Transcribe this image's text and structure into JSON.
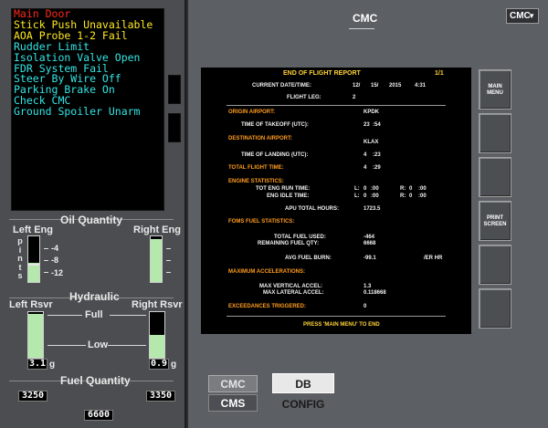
{
  "eicas": {
    "messages": [
      {
        "text": "Main Door",
        "level": "warn"
      },
      {
        "text": "Stick Push Unavailable",
        "level": "caution"
      },
      {
        "text": "AOA Probe 1-2 Fail",
        "level": "caution"
      },
      {
        "text": "Rudder Limit",
        "level": "advisory"
      },
      {
        "text": "Isolation Valve Open",
        "level": "advisory"
      },
      {
        "text": "FDR System Fail",
        "level": "advisory"
      },
      {
        "text": "Steer By Wire Off",
        "level": "advisory"
      },
      {
        "text": "Parking Brake On",
        "level": "advisory"
      },
      {
        "text": "Check CMC",
        "level": "advisory"
      },
      {
        "text": "Ground Spoiler Unarm",
        "level": "advisory"
      }
    ]
  },
  "oil": {
    "title": "Oil Quantity",
    "left_label": "Left Eng",
    "right_label": "Right Eng",
    "unit_vertical": [
      "p",
      "i",
      "n",
      "t",
      "s"
    ],
    "ticks": [
      "-4",
      "-8",
      "-12"
    ],
    "left_level": 0.42,
    "right_level": 0.95
  },
  "hydraulic": {
    "title": "Hydraulic",
    "left_label": "Left Rsvr",
    "right_label": "Right Rsvr",
    "full_label": "Full",
    "low_label": "Low",
    "left_value": "3.1",
    "right_value": "0.9",
    "unit": "g",
    "left_level": 0.97,
    "right_level": 0.5
  },
  "fuel": {
    "title": "Fuel Quantity",
    "left_value": "3250",
    "right_value": "3350",
    "total_value": "6600"
  },
  "cmc": {
    "title": "CMC",
    "select_value": "CMC",
    "select_chevron": "▼"
  },
  "report": {
    "title": "END OF FLIGHT REPORT",
    "page": "1/1",
    "date_label": "CURRENT DATE/TIME:",
    "date_month": "12/",
    "date_day": "15/",
    "date_year": "2015",
    "date_time": "4:31",
    "flight_leg_label": "FLIGHT LEG:",
    "flight_leg": "2",
    "origin_label": "ORIGIN AIRPORT:",
    "origin": "KPDK",
    "takeoff_label": "TIME OF TAKEOFF (UTC):",
    "takeoff_h": "23",
    "takeoff_m": ":54",
    "dest_label": "DESTINATION AIRPORT:",
    "dest": "KLAX",
    "landing_label": "TIME OF LANDING (UTC):",
    "landing_h": "4",
    "landing_m": ":23",
    "flight_time_label": "TOTAL FLIGHT TIME:",
    "flight_time_h": "4",
    "flight_time_m": ":29",
    "engine_stats_label": "ENGINE STATISTICS:",
    "eng_run_label": "TOT ENG RUN TIME:",
    "eng_idle_label": "ENG IDLE TIME:",
    "l_label": "L:",
    "r_label": "R:",
    "run_l_h": "0",
    "run_l_m": ":00",
    "run_r_h": "0",
    "run_r_m": ":00",
    "idle_l_h": "0",
    "idle_l_m": ":00",
    "idle_r_h": "0",
    "idle_r_m": ":00",
    "apu_label": "APU TOTAL HOURS:",
    "apu": "1723.5",
    "foms_label": "FOMS FUEL STATISTICS:",
    "fuel_used_label": "TOTAL FUEL USED:",
    "fuel_used": "-464",
    "fuel_rem_label": "REMAINING FUEL QTY:",
    "fuel_rem": "6668",
    "burn_label": "AVG FUEL BURN:",
    "burn": "-99.1",
    "burn_unit": "/ER HR",
    "accel_label": "MAXIMUM ACCELERATIONS:",
    "vert_label": "MAX VERTICAL ACCEL:",
    "vert": "1.3",
    "lat_label": "MAX LATERAL ACCEL:",
    "lat": "0.118668",
    "exceed_label": "EXCEEDANCES TRIGGERED:",
    "exceed": "0",
    "prompt": "PRESS 'MAIN MENU' TO END"
  },
  "side_buttons": {
    "main_menu_1": "MAIN",
    "main_menu_2": "MENU",
    "print_1": "PRINT",
    "print_2": "SCREEN"
  },
  "tabs": {
    "cmc": "CMC",
    "db_config": "DB CONFIG",
    "cms": "CMS"
  }
}
